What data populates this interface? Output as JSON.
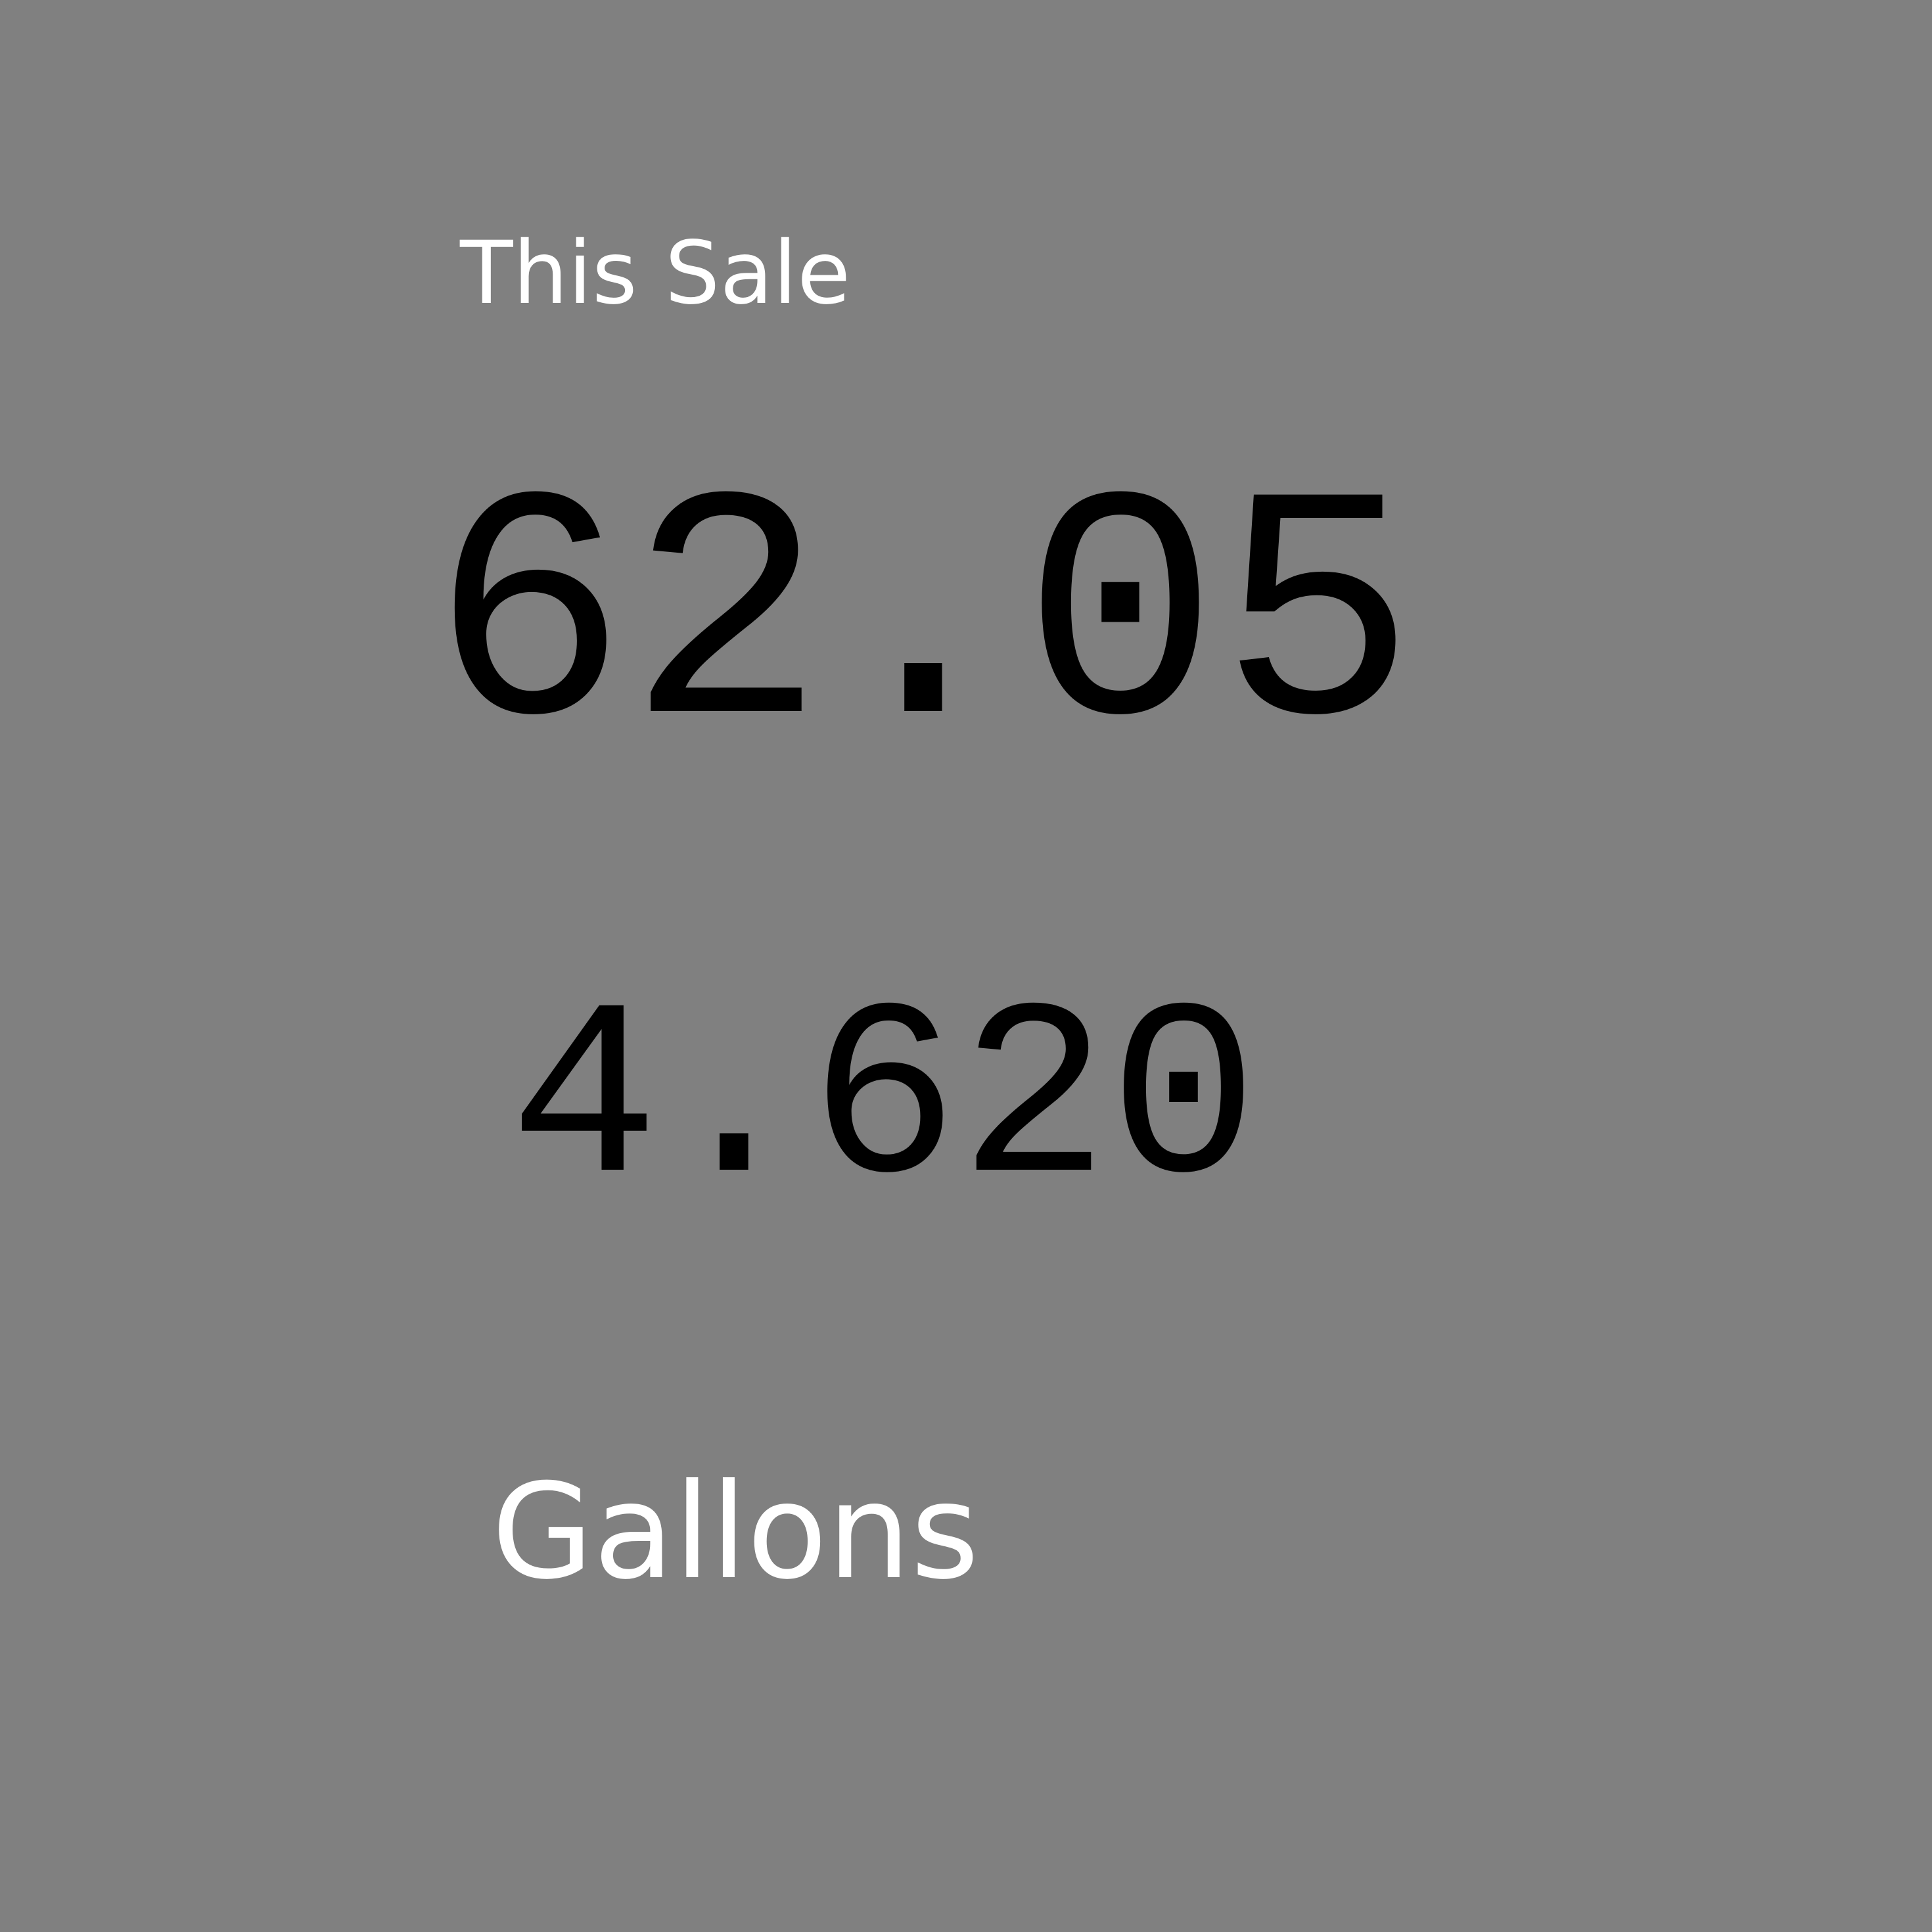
{
  "display": {
    "sale_label": "This Sale",
    "sale_amount": "62.05",
    "gallons_amount": "4.620",
    "gallons_label": "Gallons"
  },
  "colors": {
    "background": "#808080",
    "label_text": "#ffffff",
    "readout_text": "#000000"
  }
}
